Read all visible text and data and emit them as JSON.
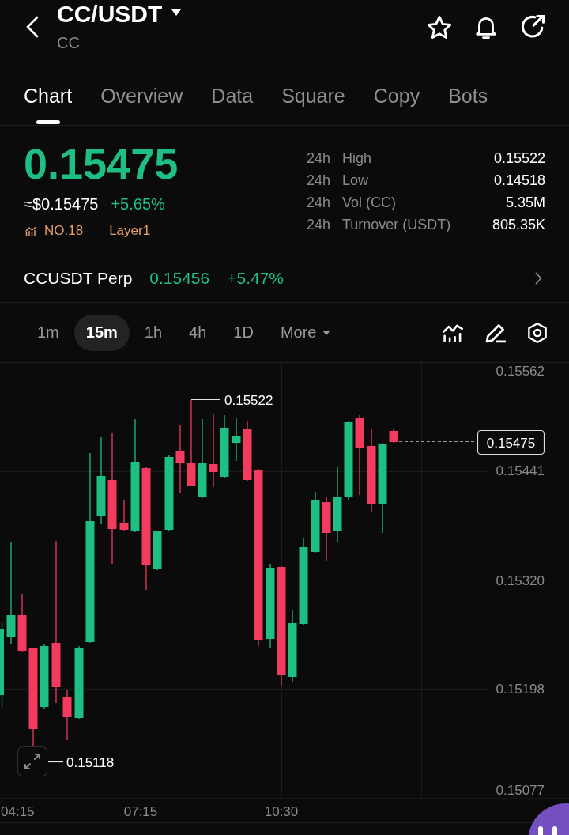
{
  "header": {
    "title": "CC/USDT",
    "subtitle": "CC"
  },
  "tabs": [
    {
      "label": "Chart",
      "selected": true
    },
    {
      "label": "Overview",
      "selected": false
    },
    {
      "label": "Data",
      "selected": false
    },
    {
      "label": "Square",
      "selected": false
    },
    {
      "label": "Copy",
      "selected": false
    },
    {
      "label": "Bots",
      "selected": false
    }
  ],
  "ticker": {
    "price": "0.15475",
    "fiat_price": "≈$0.15475",
    "change": "+5.65%",
    "rank": "NO.18",
    "tag": "Layer1"
  },
  "stats": [
    {
      "period": "24h",
      "label": "High",
      "value": "0.15522"
    },
    {
      "period": "24h",
      "label": "Low",
      "value": "0.14518"
    },
    {
      "period": "24h",
      "label": "Vol (CC)",
      "value": "5.35M"
    },
    {
      "period": "24h",
      "label": "Turnover (USDT)",
      "value": "805.35K"
    }
  ],
  "perp": {
    "name": "CCUSDT Perp",
    "price": "0.15456",
    "change": "+5.47%"
  },
  "intervals": [
    {
      "label": "1m",
      "kind": "interval",
      "selected": false
    },
    {
      "label": "15m",
      "kind": "interval",
      "selected": true
    },
    {
      "label": "1h",
      "kind": "interval",
      "selected": false
    },
    {
      "label": "4h",
      "kind": "interval",
      "selected": false
    },
    {
      "label": "1D",
      "kind": "interval",
      "selected": false
    },
    {
      "label": "More",
      "kind": "menu",
      "selected": false
    }
  ],
  "chart": {
    "y_axis_labels": [
      "0.15562",
      "0.15441",
      "0.15320",
      "0.15198",
      "0.15077"
    ],
    "x_axis_labels": [
      "04:15",
      "07:15",
      "10:30"
    ],
    "high_label": "0.15522",
    "low_label": "0.15118",
    "last_price": "0.15475"
  }
}
